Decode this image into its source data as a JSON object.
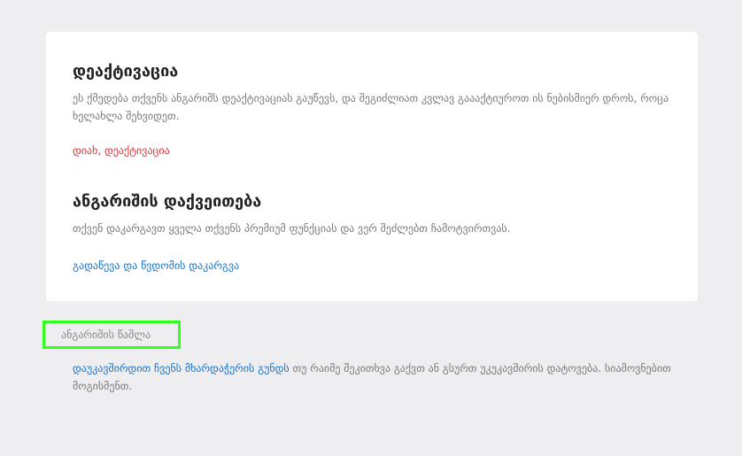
{
  "deactivation": {
    "title": "დეაქტივაცია",
    "description": "ეს ქმედება თქვენს ანგარიშს დეაქტივაციას გაუწევს, და შეგიძლიათ კვლავ გაააქტიუროთ ის ნებისმიერ დროს, როცა ხელახლა შეხვიდეთ.",
    "action_label": "დიახ, დეაქტივაცია"
  },
  "confirmation": {
    "title": "ანგარიშის დაქვეითება",
    "description": "თქვენ დაკარგავთ ყველა თქვენს პრემიუმ ფუნქციას და ვერ შეძლებთ ჩამოტვირთვას.",
    "action_label": "გადაწევა და წვდომის დაკარგვა"
  },
  "delete": {
    "label": "ანგარიშის წაშლა"
  },
  "support": {
    "link_label": "დაუკავშირდით ჩვენს მხარდაჭერის გუნდს",
    "text": " თუ რაიმე შეკითხვა გაქვთ ან გსურთ უკუკავშირის დატოვება. სიამოვნებით მოგისმენთ."
  },
  "colors": {
    "danger": "#d9363e",
    "primary": "#1a73c7",
    "highlight": "#33ff1f"
  }
}
